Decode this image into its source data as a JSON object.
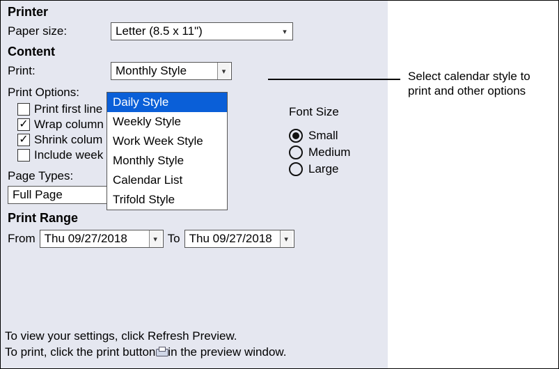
{
  "sections": {
    "printer_heading": "Printer",
    "content_heading": "Content",
    "print_range_heading": "Print Range"
  },
  "paper_size": {
    "label": "Paper size:",
    "value": "Letter (8.5 x 11\")"
  },
  "print_field": {
    "label": "Print:",
    "value": "Monthly Style",
    "options": [
      "Daily Style",
      "Weekly Style",
      "Work Week Style",
      "Monthly Style",
      "Calendar List",
      "Trifold Style"
    ],
    "highlighted": "Daily Style"
  },
  "print_options": {
    "label": "Print Options:",
    "items": [
      {
        "label": "Print first line",
        "checked": false
      },
      {
        "label": "Wrap column",
        "checked": true
      },
      {
        "label": "Shrink colum",
        "checked": true
      },
      {
        "label": "Include week",
        "checked": false
      }
    ]
  },
  "font_size": {
    "label": "Font Size",
    "options": [
      {
        "label": "Small",
        "selected": true
      },
      {
        "label": "Medium",
        "selected": false
      },
      {
        "label": "Large",
        "selected": false
      }
    ]
  },
  "page_types": {
    "label": "Page Types:",
    "value": "Full Page"
  },
  "range": {
    "from_label": "From",
    "from_value": "Thu 09/27/2018",
    "to_label": "To",
    "to_value": "Thu 09/27/2018"
  },
  "footer": {
    "line1": "To view your settings, click Refresh Preview.",
    "line2a": "To print, click the print button",
    "line2b": "in the preview window."
  },
  "callout": "Select calendar style to print and other options"
}
